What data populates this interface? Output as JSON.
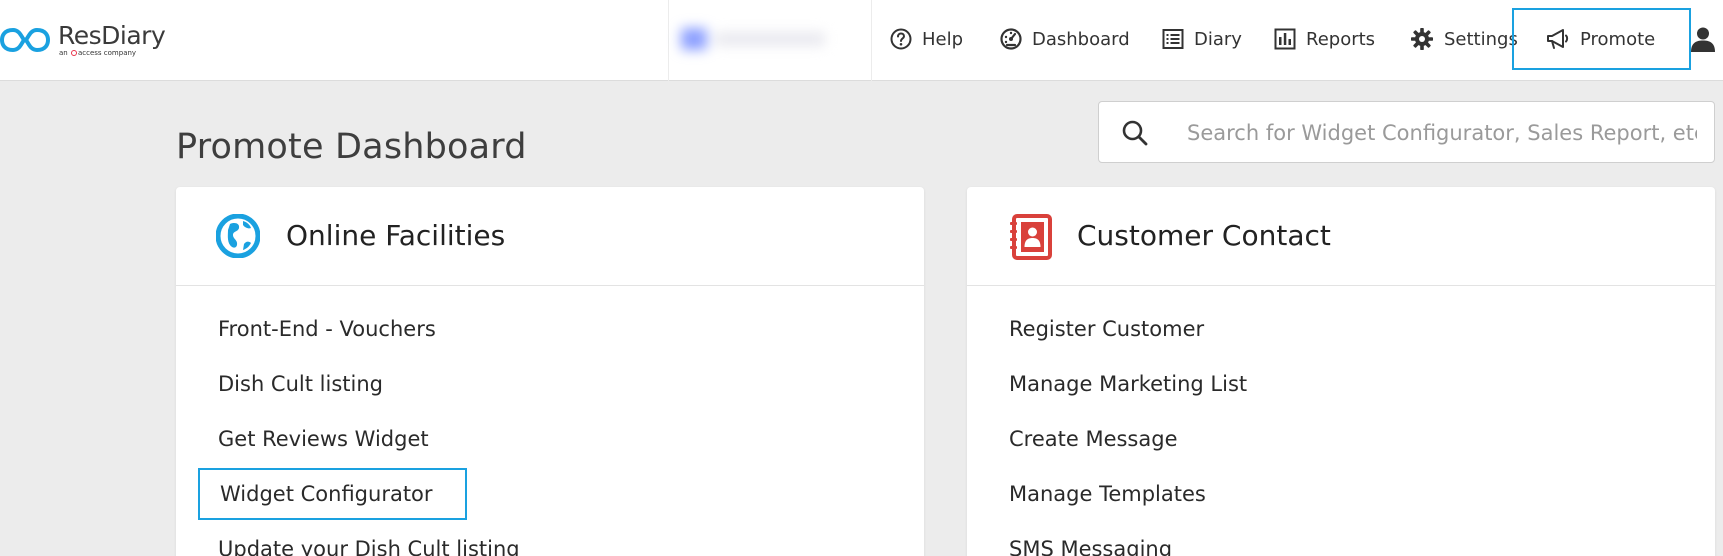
{
  "brand": {
    "name": "ResDiary",
    "tagline_prefix": "an",
    "tagline_company": "access",
    "tagline_suffix": "company",
    "accent_color": "#1aa1e0"
  },
  "nav": {
    "items": [
      {
        "label": "Help",
        "icon": "help-circle-icon"
      },
      {
        "label": "Dashboard",
        "icon": "speedometer-icon"
      },
      {
        "label": "Diary",
        "icon": "list-book-icon"
      },
      {
        "label": "Reports",
        "icon": "bar-chart-icon"
      },
      {
        "label": "Settings",
        "icon": "gear-icon"
      },
      {
        "label": "Promote",
        "icon": "megaphone-icon",
        "active": true
      }
    ],
    "user_icon": "user-icon"
  },
  "search": {
    "placeholder": "Search for Widget Configurator, Sales Report, etc.",
    "value": ""
  },
  "page": {
    "title": "Promote Dashboard"
  },
  "cards": [
    {
      "title": "Online Facilities",
      "icon": "globe-icon",
      "icon_color": "#1aa1e0",
      "links": [
        "Front-End - Vouchers",
        "Dish Cult listing",
        "Get Reviews Widget",
        "Widget Configurator",
        "Update your Dish Cult listing"
      ],
      "highlighted_link": "Widget Configurator"
    },
    {
      "title": "Customer Contact",
      "icon": "contact-book-icon",
      "icon_color": "#d9413b",
      "links": [
        "Register Customer",
        "Manage Marketing List",
        "Create Message",
        "Manage Templates",
        "SMS Messaging"
      ]
    }
  ]
}
